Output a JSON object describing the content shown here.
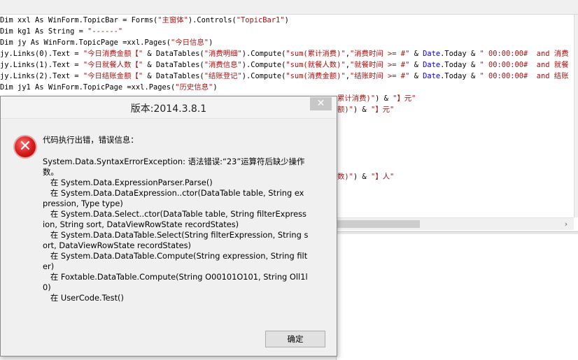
{
  "code_lines": [
    [
      {
        "t": "Dim xxl As WinForm.TopicBar = Forms(",
        "c": "txt"
      },
      {
        "t": "\"主窗体\"",
        "c": "str"
      },
      {
        "t": ").Controls(",
        "c": "txt"
      },
      {
        "t": "\"TopicBar1\"",
        "c": "str"
      },
      {
        "t": ")",
        "c": "txt"
      }
    ],
    [
      {
        "t": "Dim kg1 As String = ",
        "c": "txt"
      },
      {
        "t": "\"------\"",
        "c": "str"
      }
    ],
    [
      {
        "t": "Dim jy As WinForm.TopicPage =xxl.Pages(",
        "c": "txt"
      },
      {
        "t": "\"今日信息\"",
        "c": "str"
      },
      {
        "t": ")",
        "c": "txt"
      }
    ],
    [
      {
        "t": "jy.Links(0).Text = ",
        "c": "txt"
      },
      {
        "t": "\"今日消费金额【\"",
        "c": "str"
      },
      {
        "t": " & DataTables(",
        "c": "txt"
      },
      {
        "t": "\"消费明细\"",
        "c": "str"
      },
      {
        "t": ").Compute(",
        "c": "txt"
      },
      {
        "t": "\"sum(累计消费)\"",
        "c": "str"
      },
      {
        "t": ",",
        "c": "txt"
      },
      {
        "t": "\"消费时间 >= #\"",
        "c": "str"
      },
      {
        "t": " & ",
        "c": "txt"
      },
      {
        "t": "Date",
        "c": "kw"
      },
      {
        "t": ".Today & ",
        "c": "txt"
      },
      {
        "t": "\" 00:00:00#  and 消费",
        "c": "str"
      }
    ],
    [
      {
        "t": "jy.Links(1).Text = ",
        "c": "txt"
      },
      {
        "t": "\"今日就餐人数【\"",
        "c": "str"
      },
      {
        "t": " & DataTables(",
        "c": "txt"
      },
      {
        "t": "\"消费信息\"",
        "c": "str"
      },
      {
        "t": ").Compute(",
        "c": "txt"
      },
      {
        "t": "\"sum(就餐人数)\"",
        "c": "str"
      },
      {
        "t": ",",
        "c": "txt"
      },
      {
        "t": "\"就餐时间 >= #\"",
        "c": "str"
      },
      {
        "t": " & ",
        "c": "txt"
      },
      {
        "t": "Date",
        "c": "kw"
      },
      {
        "t": ".Today & ",
        "c": "txt"
      },
      {
        "t": "\" 00:00:00#  and 就餐",
        "c": "str"
      }
    ],
    [
      {
        "t": "jy.Links(2).Text = ",
        "c": "txt"
      },
      {
        "t": "\"今日结账金额【\"",
        "c": "str"
      },
      {
        "t": " & DataTables(",
        "c": "txt"
      },
      {
        "t": "\"结账登记\"",
        "c": "str"
      },
      {
        "t": ").Compute(",
        "c": "txt"
      },
      {
        "t": "\"sum(消费金额)\"",
        "c": "str"
      },
      {
        "t": ",",
        "c": "txt"
      },
      {
        "t": "\"结账时间 >= #\"",
        "c": "str"
      },
      {
        "t": " & ",
        "c": "txt"
      },
      {
        "t": "Date",
        "c": "kw"
      },
      {
        "t": ".Today & ",
        "c": "txt"
      },
      {
        "t": "\" 00:00:00#  and 结账",
        "c": "str"
      }
    ],
    [
      {
        "t": "Dim jy1 As WinForm.TopicPage =xxl.Pages(",
        "c": "txt"
      },
      {
        "t": "\"历史信息\"",
        "c": "str"
      },
      {
        "t": ")",
        "c": "txt"
      }
    ]
  ],
  "code_fragments": [
    [
      {
        "t": "累计消费)\"",
        "c": "str"
      },
      {
        "t": ") & ",
        "c": "txt"
      },
      {
        "t": "\"】元\"",
        "c": "str"
      }
    ],
    [
      {
        "t": "额)\"",
        "c": "str"
      },
      {
        "t": ") & ",
        "c": "txt"
      },
      {
        "t": "\"】元\"",
        "c": "str"
      }
    ],
    [
      {
        "t": "数)\"",
        "c": "str"
      },
      {
        "t": ") & ",
        "c": "txt"
      },
      {
        "t": "\"】人\"",
        "c": "str"
      }
    ]
  ],
  "scrollbar": {
    "right_arrow": "›"
  },
  "dialog": {
    "title": "版本:2014.3.8.1",
    "close_label": "✕",
    "icon_glyph": "✕",
    "headline": "代码执行出错，错误信息：",
    "message_lines": [
      "System.Data.SyntaxErrorException: 语法错误:“23”运算符后缺少操作数。",
      "   在 System.Data.ExpressionParser.Parse()",
      "   在 System.Data.DataExpression..ctor(DataTable table, String expression, Type type)",
      "   在 System.Data.Select..ctor(DataTable table, String filterExpression, String sort, DataViewRowState recordStates)",
      "   在 System.Data.DataTable.Select(String filterExpression, String sort, DataViewRowState recordStates)",
      "   在 System.Data.DataTable.Compute(String expression, String filter)",
      "   在 Foxtable.DataTable.Compute(String O00101O101, String Oll1l0)",
      "   在 UserCode.Test()"
    ],
    "ok_label": "确定"
  },
  "colors": {
    "string": "#a31515",
    "keyword": "#0000ff",
    "error_icon": "#d51a1a"
  }
}
